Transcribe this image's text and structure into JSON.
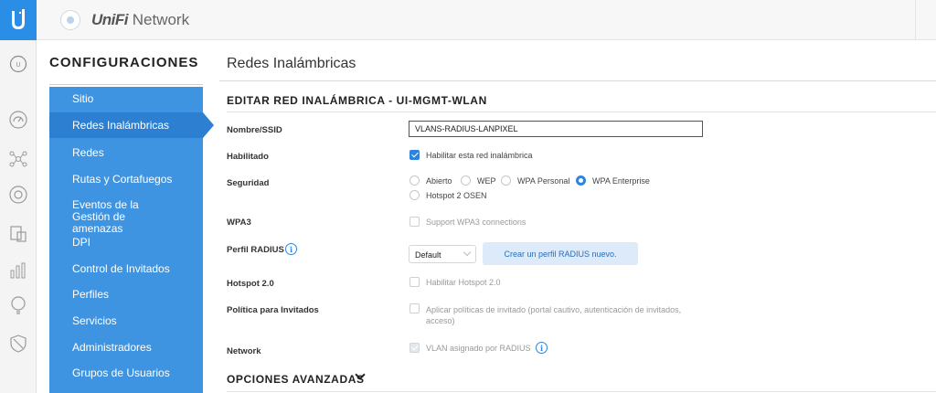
{
  "app": {
    "brand_main": "UniFi",
    "brand_sub": "Network",
    "controller_badge": "U"
  },
  "icons": {
    "logo": "ubiquiti-u-logo",
    "rail": [
      "controller-icon",
      "dashboard-icon",
      "topology-icon",
      "devices-icon",
      "clients-icon",
      "statistics-icon",
      "insights-icon",
      "threat-management-icon"
    ]
  },
  "sidebar": {
    "heading": "CONFIGURACIONES",
    "items": [
      {
        "label": "Sitio",
        "active": false
      },
      {
        "label": "Redes Inalámbricas",
        "active": true
      },
      {
        "label": "Redes",
        "active": false
      },
      {
        "label": "Rutas y Cortafuegos",
        "active": false
      },
      {
        "label": "Eventos de la Gestión de amenazas",
        "active": false
      },
      {
        "label": "DPI",
        "active": false
      },
      {
        "label": "Control de Invitados",
        "active": false
      },
      {
        "label": "Perfiles",
        "active": false
      },
      {
        "label": "Servicios",
        "active": false
      },
      {
        "label": "Administradores",
        "active": false
      },
      {
        "label": "Grupos de Usuarios",
        "active": false
      }
    ]
  },
  "main": {
    "page_title": "Redes Inalámbricas",
    "section_title": "EDITAR RED INALÁMBRICA - UI-MGMT-WLAN",
    "fields": {
      "ssid": {
        "label": "Nombre/SSID",
        "value": "VLANS-RADIUS-LANPIXEL"
      },
      "enabled": {
        "label": "Habilitado",
        "option": "Habilitar esta red inalámbrica",
        "checked": true
      },
      "security": {
        "label": "Seguridad",
        "options": [
          "Abierto",
          "WEP",
          "WPA Personal",
          "WPA Enterprise",
          "Hotspot 2 OSEN"
        ],
        "selected": "WPA Enterprise"
      },
      "wpa3": {
        "label": "WPA3",
        "option": "Support WPA3 connections",
        "checked": false
      },
      "radius": {
        "label": "Perfil RADIUS",
        "value": "Default",
        "button": "Crear un perfil RADIUS nuevo."
      },
      "hotspot": {
        "label": "Hotspot 2.0",
        "option": "Habilitar Hotspot 2.0",
        "checked": false
      },
      "guest_policy": {
        "label": "Política para Invitados",
        "option": "Aplicar políticas de invitado (portal cautivo, autenticación de invitados, acceso)",
        "checked": false
      },
      "network": {
        "label": "Network",
        "option": "VLAN asignado por RADIUS",
        "checked": true
      }
    },
    "advanced": "OPCIONES AVANZADAS"
  },
  "colors": {
    "accent": "#2f83dd",
    "sidebar_bg": "#3f94e2",
    "sidebar_active": "#2d7fd1",
    "logo_bg": "#2a8ee6"
  }
}
